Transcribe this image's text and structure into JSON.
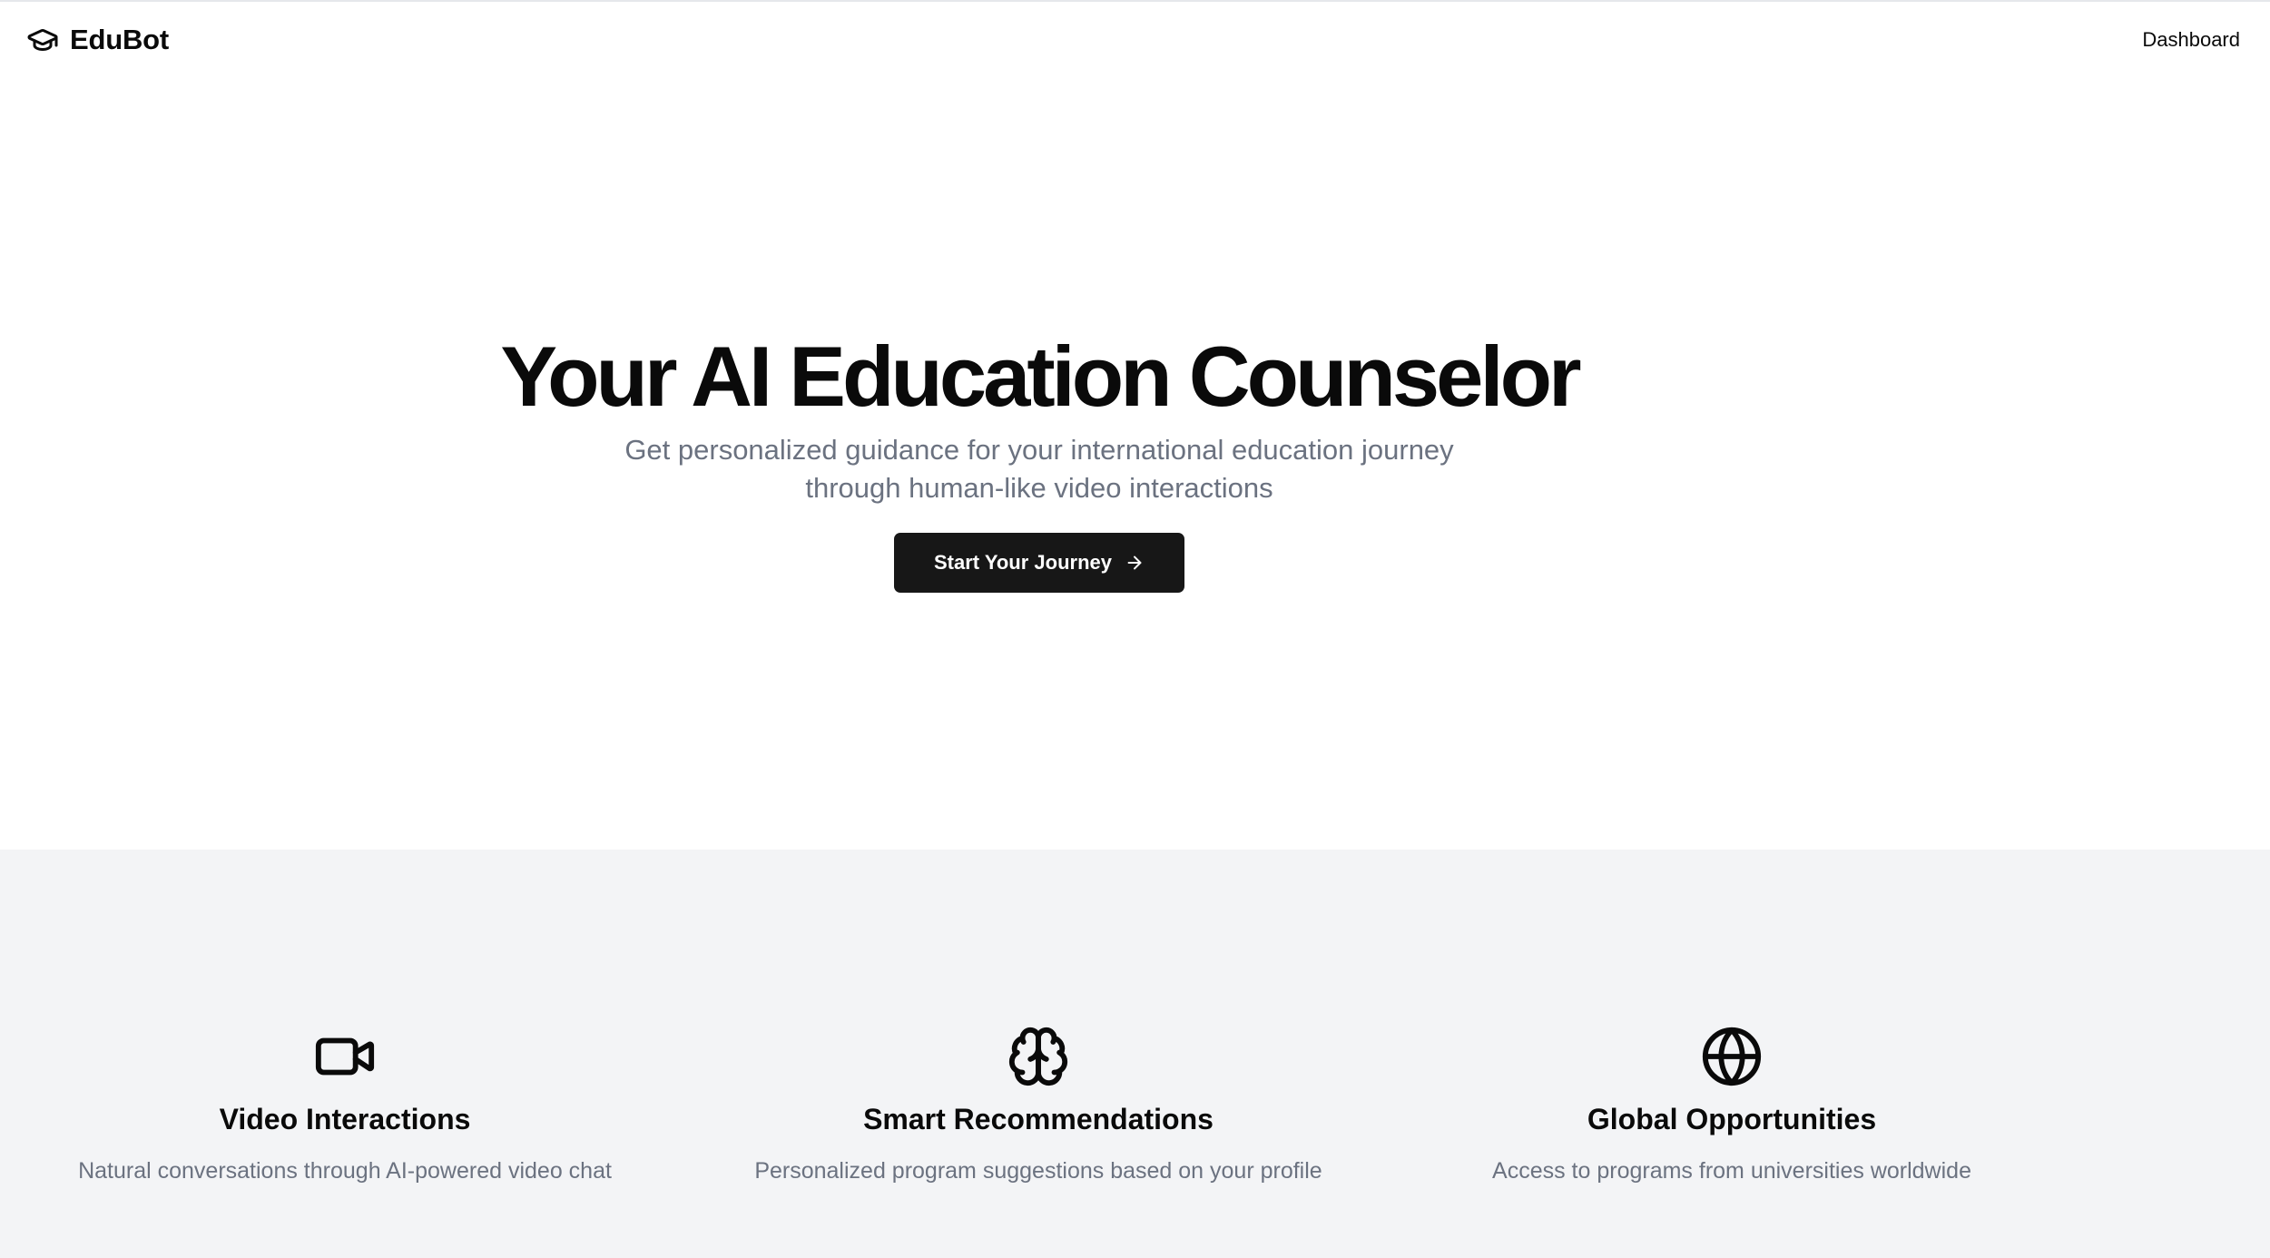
{
  "header": {
    "brand": "EduBot",
    "brand_icon": "graduation-cap-icon",
    "nav_dashboard": "Dashboard"
  },
  "hero": {
    "title": "Your AI Education Counselor",
    "subtitle": "Get personalized guidance for your international education journey through human-like video interactions",
    "cta_label": "Start Your Journey",
    "cta_icon": "arrow-right-icon"
  },
  "features": [
    {
      "icon": "video-camera-icon",
      "title": "Video Interactions",
      "description": "Natural conversations through AI-powered video chat"
    },
    {
      "icon": "brain-icon",
      "title": "Smart Recommendations",
      "description": "Personalized program suggestions based on your profile"
    },
    {
      "icon": "globe-icon",
      "title": "Global Opportunities",
      "description": "Access to programs from universities worldwide"
    }
  ],
  "colors": {
    "primary": "#171717",
    "text": "#0a0a0a",
    "muted": "#6b7280",
    "section_bg": "#f3f4f6"
  }
}
